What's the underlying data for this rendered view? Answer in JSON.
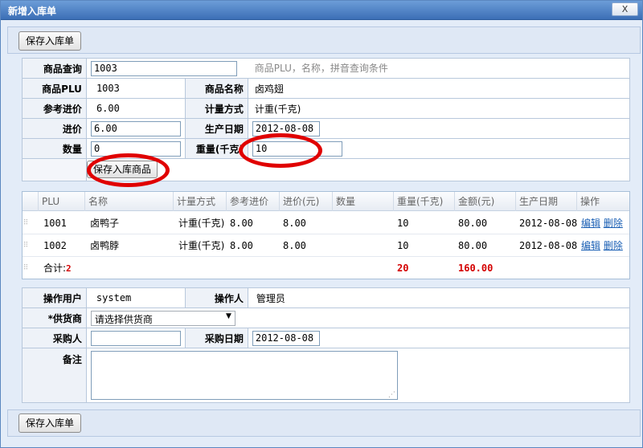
{
  "window": {
    "title": "新增入库单",
    "close_label": "X"
  },
  "toolbar": {
    "save_label": "保存入库单"
  },
  "form": {
    "query_label": "商品查询",
    "query_value": "1003",
    "query_hint": "商品PLU，名称，拼音查询条件",
    "plu_label": "商品PLU",
    "plu_value": "1003",
    "name_label": "商品名称",
    "name_value": "卤鸡翅",
    "ref_price_label": "参考进价",
    "ref_price_value": "6.00",
    "unit_label": "计量方式",
    "unit_value": "计重(千克)",
    "price_label": "进价",
    "price_value": "6.00",
    "date_label": "生产日期",
    "date_value": "2012-08-08",
    "qty_label": "数量",
    "qty_value": "0",
    "weight_label": "重量(千克)",
    "weight_value": "10",
    "save_item_label": "保存入库商品"
  },
  "grid": {
    "columns": [
      "PLU",
      "名称",
      "计量方式",
      "参考进价",
      "进价(元)",
      "数量",
      "重量(千克)",
      "金额(元)",
      "生产日期",
      "操作"
    ],
    "rows": [
      {
        "plu": "1001",
        "name": "卤鸭子",
        "unit": "计重(千克)",
        "ref": "8.00",
        "price": "8.00",
        "qty": "",
        "weight": "10",
        "amount": "80.00",
        "date": "2012-08-08",
        "edit": "编辑",
        "del": "删除"
      },
      {
        "plu": "1002",
        "name": "卤鸭脖",
        "unit": "计重(千克)",
        "ref": "8.00",
        "price": "8.00",
        "qty": "",
        "weight": "10",
        "amount": "80.00",
        "date": "2012-08-08",
        "edit": "编辑",
        "del": "删除"
      }
    ],
    "summary": {
      "label": "合计:",
      "count": "2",
      "weight": "20",
      "amount": "160.00"
    }
  },
  "bottom": {
    "user_label": "操作用户",
    "user_value": "system",
    "operator_label": "操作人",
    "operator_value": "管理员",
    "supplier_label": "*供货商",
    "supplier_value": "请选择供货商",
    "buyer_label": "采购人",
    "buyer_value": "",
    "purchase_date_label": "采购日期",
    "purchase_date_value": "2012-08-08",
    "note_label": "备注",
    "note_value": ""
  },
  "colors": {
    "title_bar": "#3c6fb6",
    "annotation": "#e00000",
    "total": "#d40000",
    "link": "#1a5fb4"
  }
}
